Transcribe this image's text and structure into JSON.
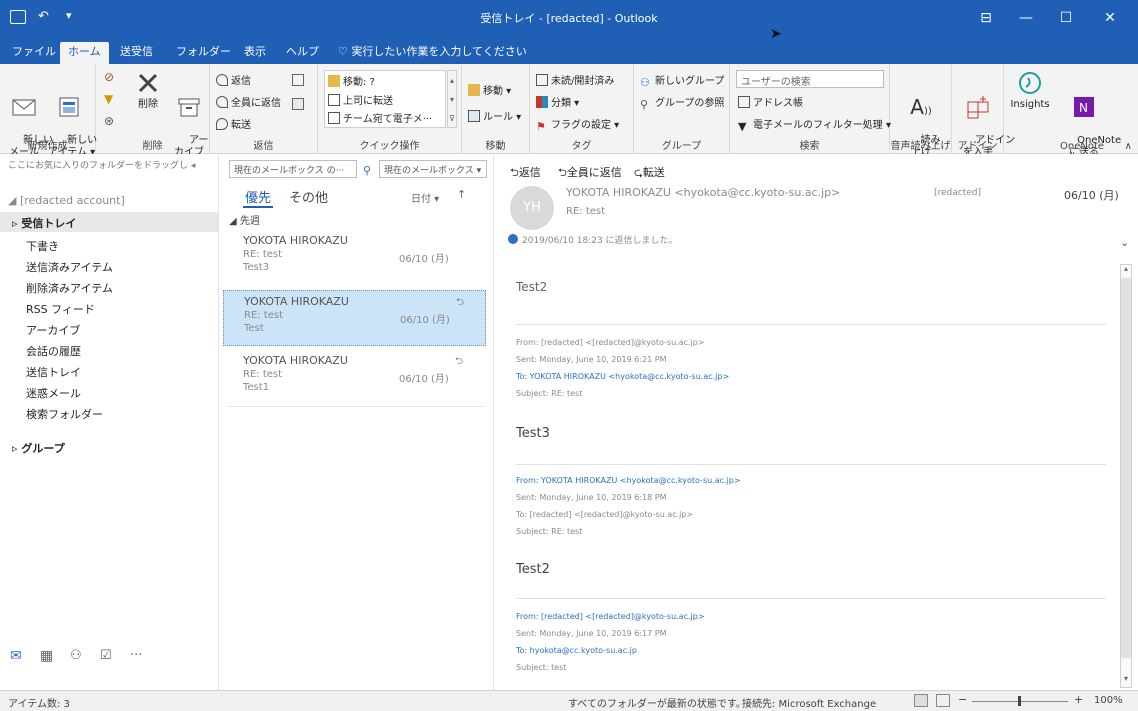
{
  "window": {
    "title": "受信トレイ - [redacted] - Outlook",
    "controls": {
      "minimize": "—",
      "maximize": "☐",
      "close": "✕",
      "ribbon_display": "⊟"
    }
  },
  "tabs": {
    "items": [
      "ファイル",
      "ホーム",
      "送受信",
      "フォルダー",
      "表示",
      "ヘルプ"
    ],
    "tell_me": "実行したい作業を入力してください"
  },
  "ribbon": {
    "new": {
      "new_mail": "新しい\nメール",
      "new_items": "新しい\nアイテム ▾",
      "label": "新規作成"
    },
    "delete": {
      "delete": "削除",
      "archive": "アー\nカイブ",
      "label": "削除"
    },
    "respond": {
      "reply": "返信",
      "reply_all": "全員に返信",
      "forward": "転送",
      "label": "返信"
    },
    "quick_steps": {
      "move_to": "移動: ?",
      "to_manager": "上司に転送",
      "team_email": "チーム宛て電子メ···",
      "label": "クイック操作"
    },
    "move": {
      "move": "移動 ▾",
      "rules": "ルール ▾",
      "label": "移動"
    },
    "tags": {
      "unread_read": "未読/開封済み",
      "categorize": "分類 ▾",
      "follow_up": "フラグの設定 ▾",
      "label": "タグ"
    },
    "groups": {
      "new_group": "新しいグループ",
      "browse_groups": "グループの参照",
      "label": "グループ"
    },
    "find": {
      "search_people": "ユーザーの検索",
      "address_book": "アドレス帳",
      "filter_email": "電子メールのフィルター処理 ▾",
      "label": "検索"
    },
    "speech": {
      "read_aloud": "読み\n上げ",
      "label": "音声読み上げ"
    },
    "addins": {
      "get_addins": "アドイン\nを入手",
      "label": "アドイン"
    },
    "insights": {
      "label": "Insights"
    },
    "onenote": {
      "send": "OneNote\nに送る",
      "label": "OneNote"
    }
  },
  "nav": {
    "drag_hint": "ここにお気に入りのフォルダーをドラッグし",
    "account": "[redacted account]",
    "inbox": "受信トレイ",
    "folders": [
      "下書き",
      "送信済みアイテム",
      "削除済みアイテム",
      "RSS フィード",
      "アーカイブ",
      "会話の履歴",
      "送信トレイ",
      "迷惑メール",
      "検索フォルダー"
    ],
    "groups": "グループ",
    "more": "···"
  },
  "list": {
    "search_placeholder": "現在のメールボックス の···",
    "scope": "現在のメールボックス ▾",
    "focused": "優先",
    "other": "その他",
    "sort": "日付 ▾",
    "sort_dir": "↑",
    "section": "先週",
    "items": [
      {
        "sender": "YOKOTA HIROKAZU",
        "subject": "RE: test",
        "preview": "Test3",
        "date": "06/10 (月)"
      },
      {
        "sender": "YOKOTA HIROKAZU",
        "subject": "RE: test",
        "preview": "Test",
        "date": "06/10 (月)"
      },
      {
        "sender": "YOKOTA HIROKAZU",
        "subject": "RE: test",
        "preview": "Test1",
        "date": "06/10 (月)"
      }
    ]
  },
  "reading": {
    "actions": {
      "reply": "返信",
      "reply_all": "全員に返信",
      "forward": "転送"
    },
    "avatar": "YH",
    "from": "YOKOTA HIROKAZU <hyokota@cc.kyoto-su.ac.jp>",
    "to_short": "[redacted]",
    "date": "06/10 (月)",
    "subject": "RE: test",
    "info": "2019/06/10 18:23 に返信しました。",
    "body": {
      "p1": "Test2",
      "h1": {
        "from": "From: [redacted] <[redacted]@kyoto-su.ac.jp>",
        "sent": "Sent: Monday, June 10, 2019 6:21 PM",
        "to": "To: YOKOTA HIROKAZU <hyokota@cc.kyoto-su.ac.jp>",
        "subject": "Subject: RE: test"
      },
      "p2": "Test3",
      "h2": {
        "from": "From: YOKOTA HIROKAZU <hyokota@cc.kyoto-su.ac.jp>",
        "sent": "Sent: Monday, June 10, 2019 6:18 PM",
        "to": "To: [redacted] <[redacted]@kyoto-su.ac.jp>",
        "subject": "Subject: RE: test"
      },
      "p3": "Test2",
      "h3": {
        "from": "From: [redacted] <[redacted]@kyoto-su.ac.jp>",
        "sent": "Sent: Monday, June 10, 2019 6:17 PM",
        "to": "To: hyokota@cc.kyoto-su.ac.jp",
        "subject": "Subject: test"
      }
    }
  },
  "status": {
    "items": "アイテム数: 3",
    "folders_uptodate": "すべてのフォルダーが最新の状態です。",
    "connection": "接続先: Microsoft Exchange",
    "zoom": "100%",
    "minus": "−",
    "plus": "+"
  },
  "colors": {
    "titlebar": "#1f5fb5",
    "ribbon": "#f3f3f3",
    "selection": "#cce4f7",
    "link": "#2b6fc7"
  }
}
